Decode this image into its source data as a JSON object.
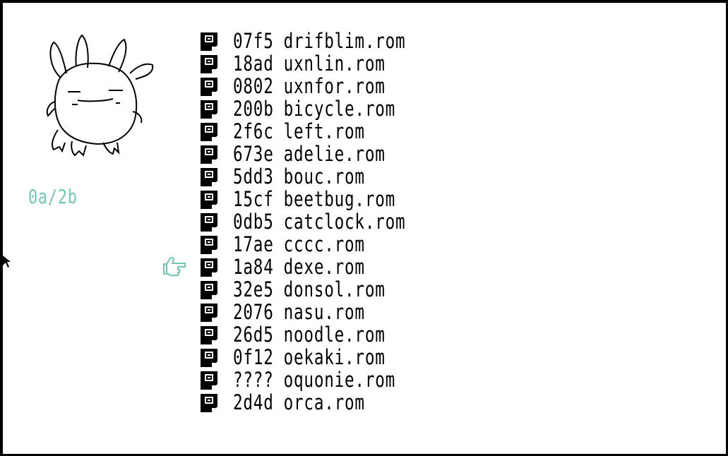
{
  "counter": "0a/2b",
  "icons": {
    "mascot": "rabbit-mascot",
    "file": "rom-file-icon",
    "selector": "pointing-hand-icon",
    "cursor": "mouse-arrow-cursor"
  },
  "colors": {
    "background": "#ffffff",
    "frame": "#000000",
    "text": "#000000",
    "accent": "#6fc7b4"
  },
  "selected_index": 10,
  "files": [
    {
      "size": "07f5",
      "name": "drifblim.rom"
    },
    {
      "size": "18ad",
      "name": "uxnlin.rom"
    },
    {
      "size": "0802",
      "name": "uxnfor.rom"
    },
    {
      "size": "200b",
      "name": "bicycle.rom"
    },
    {
      "size": "2f6c",
      "name": "left.rom"
    },
    {
      "size": "673e",
      "name": "adelie.rom"
    },
    {
      "size": "5dd3",
      "name": "bouc.rom"
    },
    {
      "size": "15cf",
      "name": "beetbug.rom"
    },
    {
      "size": "0db5",
      "name": "catclock.rom"
    },
    {
      "size": "17ae",
      "name": "cccc.rom"
    },
    {
      "size": "1a84",
      "name": "dexe.rom"
    },
    {
      "size": "32e5",
      "name": "donsol.rom"
    },
    {
      "size": "2076",
      "name": "nasu.rom"
    },
    {
      "size": "26d5",
      "name": "noodle.rom"
    },
    {
      "size": "0f12",
      "name": "oekaki.rom"
    },
    {
      "size": "????",
      "name": "oquonie.rom"
    },
    {
      "size": "2d4d",
      "name": "orca.rom"
    }
  ]
}
